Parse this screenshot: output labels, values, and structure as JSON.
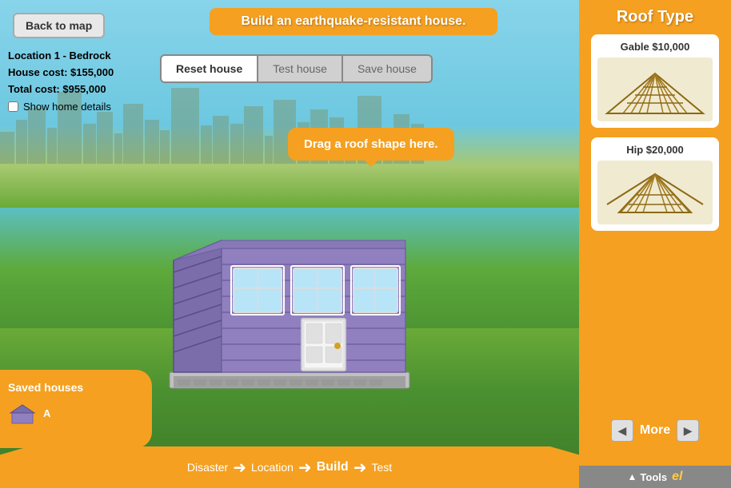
{
  "header": {
    "back_label": "Back to map",
    "title": "Build an earthquake-resistant house."
  },
  "info": {
    "location": "Location 1 - Bedrock",
    "house_cost": "House cost: $155,000",
    "total_cost": "Total cost: $955,000",
    "show_home": "Show home details"
  },
  "action_buttons": {
    "reset": "Reset house",
    "test": "Test house",
    "save": "Save house"
  },
  "drag_tooltip": "Drag a roof shape here.",
  "saved_houses": {
    "title": "Saved houses",
    "item_label": "A"
  },
  "right_panel": {
    "title": "Roof Type",
    "roof_options": [
      {
        "label": "Gable $10,000"
      },
      {
        "label": "Hip $20,000"
      }
    ],
    "more_label": "More"
  },
  "bottom_nav": {
    "steps": [
      {
        "label": "Disaster",
        "active": false
      },
      {
        "label": "Location",
        "active": false
      },
      {
        "label": "Build",
        "active": true
      },
      {
        "label": "Test",
        "active": false
      }
    ]
  },
  "tools": {
    "label": "Tools"
  }
}
